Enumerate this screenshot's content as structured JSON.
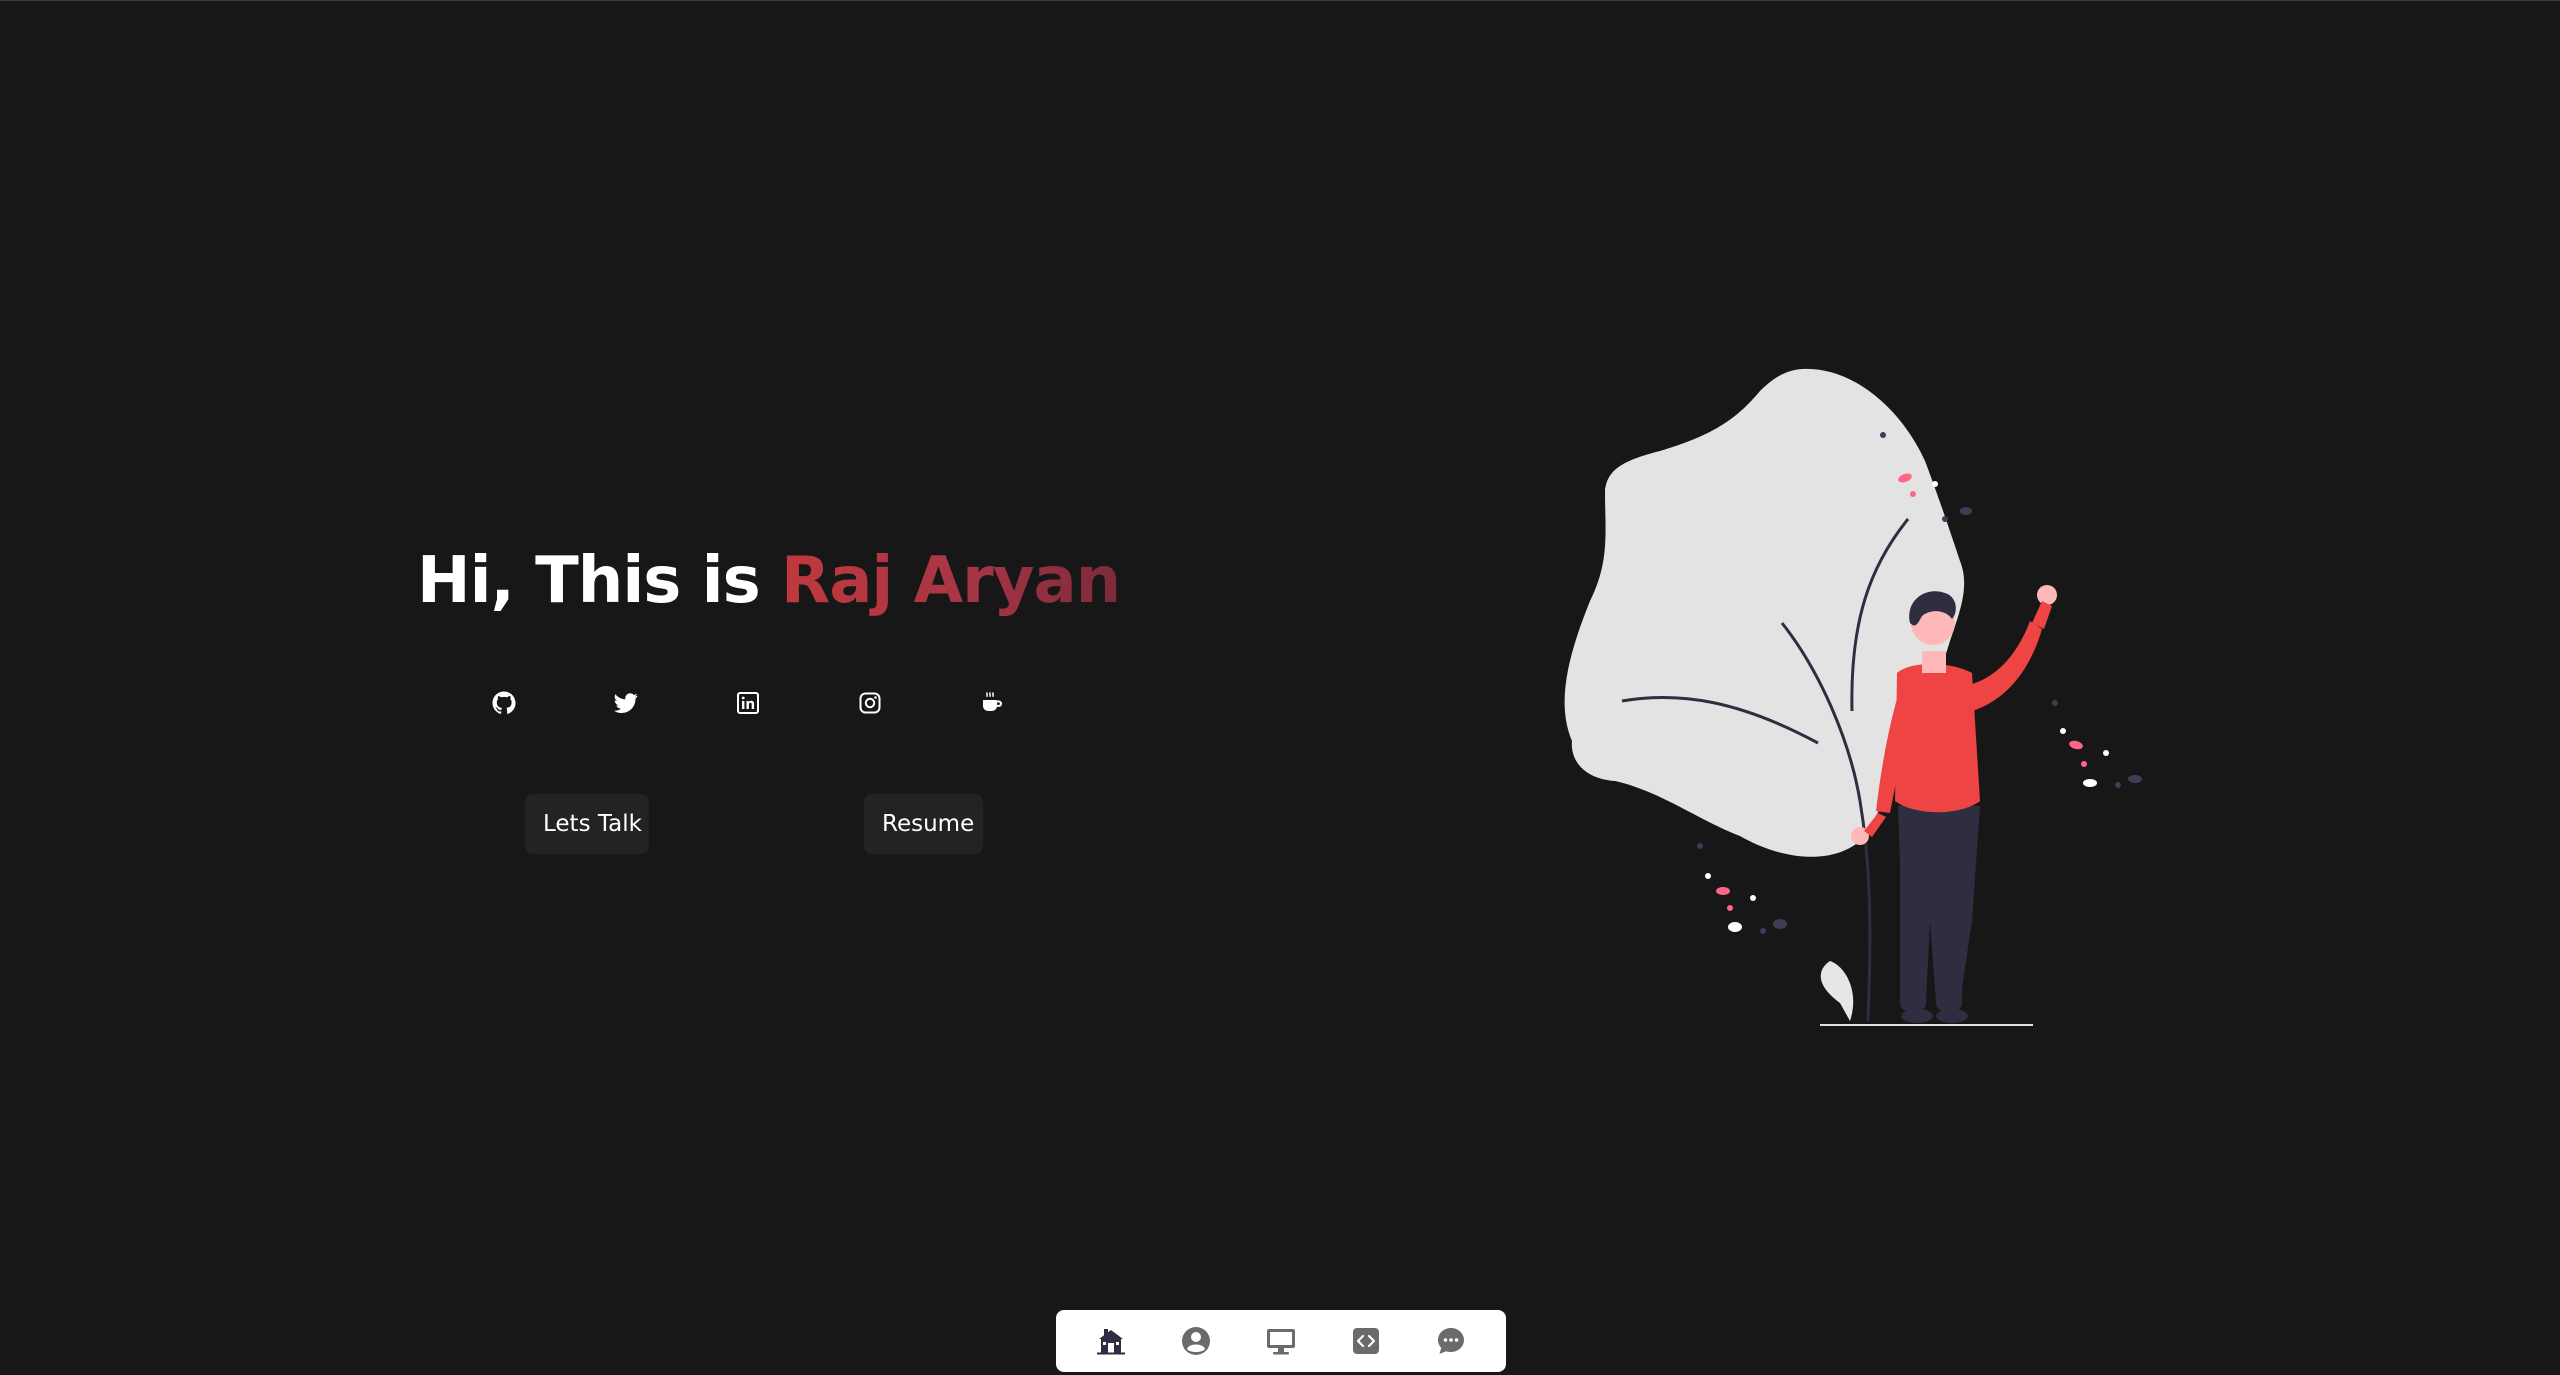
{
  "hero": {
    "greeting": "Hi, This is ",
    "name": "Raj Aryan",
    "name_gradient": [
      "#c0393e",
      "#7b2a3a"
    ]
  },
  "socials": [
    {
      "icon": "github-icon"
    },
    {
      "icon": "twitter-icon"
    },
    {
      "icon": "linkedin-icon"
    },
    {
      "icon": "instagram-icon"
    },
    {
      "icon": "coffee-icon"
    }
  ],
  "buttons": {
    "talk_label": "Lets Talk",
    "resume_label": "Resume"
  },
  "bottom_nav": {
    "items": [
      {
        "icon": "home-icon",
        "active": true
      },
      {
        "icon": "user-icon"
      },
      {
        "icon": "monitor-icon"
      },
      {
        "icon": "code-icon"
      },
      {
        "icon": "chat-icon"
      }
    ]
  },
  "colors": {
    "background": "#171717",
    "accent": "#ef4444",
    "button_bg": "#232323",
    "nav_bg": "#ffffff",
    "nav_icon": "#6b6b6b",
    "nav_icon_active": "#2f2e41"
  }
}
